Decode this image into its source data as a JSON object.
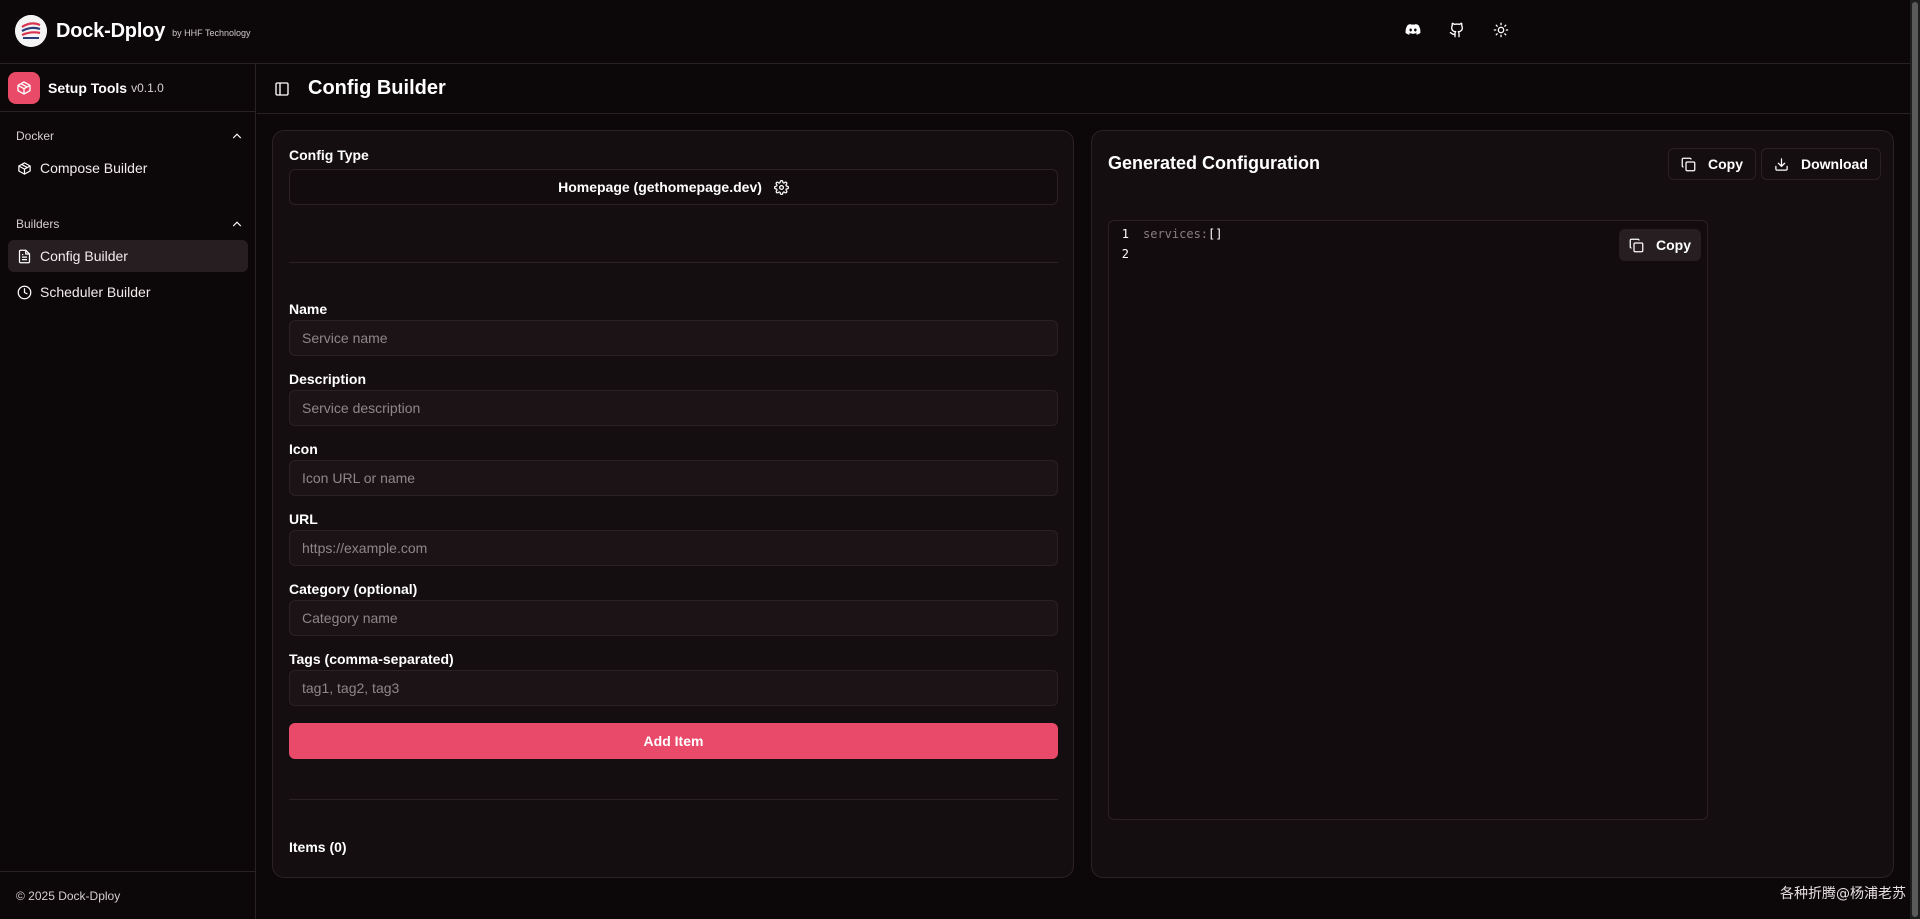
{
  "header": {
    "brand_name": "Dock-Dploy",
    "brand_by": "by HHF Technology",
    "icons": [
      "discord-icon",
      "github-icon",
      "sun-icon"
    ]
  },
  "sidebar": {
    "app_title": "Setup Tools",
    "app_version": "v0.1.0",
    "groups": [
      {
        "label": "Docker",
        "items": [
          {
            "label": "Compose Builder",
            "icon": "box-icon"
          }
        ]
      },
      {
        "label": "Builders",
        "items": [
          {
            "label": "Config Builder",
            "icon": "file-text-icon",
            "active": true
          },
          {
            "label": "Scheduler Builder",
            "icon": "clock-icon"
          }
        ]
      }
    ],
    "footer": "© 2025 Dock-Dploy"
  },
  "main": {
    "title": "Config Builder"
  },
  "form": {
    "config_type_label": "Config Type",
    "config_type_value": "Homepage (gethomepage.dev)",
    "fields": [
      {
        "label": "Name",
        "placeholder": "Service name"
      },
      {
        "label": "Description",
        "placeholder": "Service description"
      },
      {
        "label": "Icon",
        "placeholder": "Icon URL or name"
      },
      {
        "label": "URL",
        "placeholder": "https://example.com"
      },
      {
        "label": "Category (optional)",
        "placeholder": "Category name"
      },
      {
        "label": "Tags (comma-separated)",
        "placeholder": "tag1, tag2, tag3"
      }
    ],
    "add_button": "Add Item",
    "items_count": "Items (0)"
  },
  "output": {
    "title": "Generated Configuration",
    "copy_label": "Copy",
    "download_label": "Download",
    "inner_copy_label": "Copy",
    "lines": [
      {
        "no": "1",
        "key": "services:",
        "value": " []"
      },
      {
        "no": "2",
        "key": "",
        "value": ""
      }
    ]
  },
  "watermark": "各种折腾@杨浦老苏",
  "colors": {
    "accent": "#ea4a6a",
    "background": "#0c0708",
    "card": "#150e10",
    "border": "#2a2124"
  }
}
